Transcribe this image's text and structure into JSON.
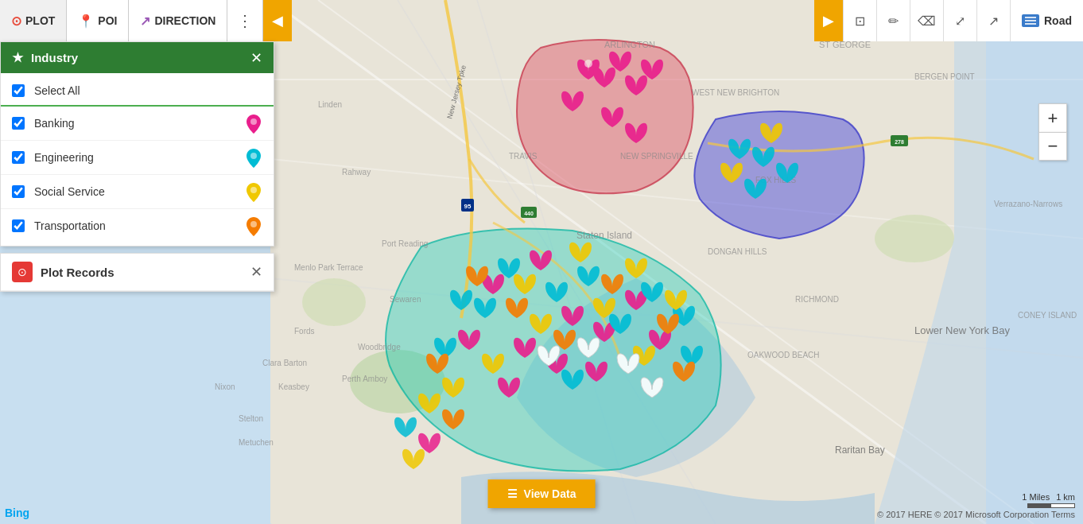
{
  "toolbar": {
    "plot_label": "PLOT",
    "poi_label": "POI",
    "direction_label": "DIRECTION",
    "road_label": "Road",
    "collapse_char": "◀",
    "expand_char": "▶",
    "dots": "⋮"
  },
  "tools": {
    "select_icon": "⬜",
    "pencil_icon": "✏",
    "eraser_icon": "⌫",
    "fullscreen_icon": "⤢",
    "share_icon": "↗"
  },
  "industry": {
    "title": "Industry",
    "items": [
      {
        "label": "Select All",
        "checked": true,
        "color": null
      },
      {
        "label": "Banking",
        "checked": true,
        "color": "#e91e8c"
      },
      {
        "label": "Engineering",
        "checked": true,
        "color": "#00bcd4"
      },
      {
        "label": "Social Service",
        "checked": true,
        "color": "#f0c800"
      },
      {
        "label": "Transportation",
        "checked": true,
        "color": "#f57c00"
      }
    ]
  },
  "plot_records": {
    "title": "Plot Records"
  },
  "view_data": {
    "icon": "☰",
    "label": "View Data"
  },
  "scale": {
    "miles": "1 Miles",
    "km": "1 km"
  },
  "copyright": "© 2017 HERE © 2017 Microsoft Corporation  Terms",
  "bing": "Bing"
}
